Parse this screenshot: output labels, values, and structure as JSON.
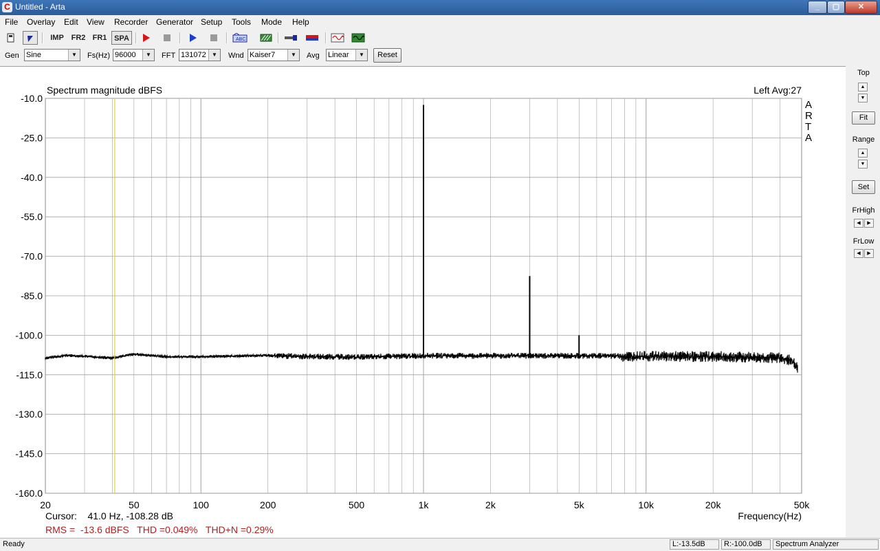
{
  "window": {
    "app_icon": "arta-icon",
    "title": "Untitled - Arta",
    "controls": [
      "minimize-icon",
      "maximize-icon",
      "close-icon"
    ]
  },
  "menu": [
    "File",
    "Overlay",
    "Edit",
    "View",
    "Recorder",
    "Generator",
    "Setup",
    "Tools",
    "Mode",
    "Help"
  ],
  "toolbar": {
    "imp": "IMP",
    "fr2": "FR2",
    "fr1": "FR1",
    "spa": "SPA",
    "icons": [
      "new-icon",
      "cursor-icon",
      "impulse-mode-icon",
      "fr2-mode-icon",
      "fr1-mode-icon",
      "spectrum-mode-icon",
      "record-icon",
      "stop-record-icon",
      "play-icon",
      "stop-play-icon",
      "abc-icon",
      "hatch-icon",
      "probe-icon",
      "level-meter-icon",
      "scope-icon",
      "generator-icon"
    ]
  },
  "controls": {
    "gen_label": "Gen",
    "gen_value": "Sine",
    "fs_label": "Fs(Hz)",
    "fs_value": "96000",
    "fft_label": "FFT",
    "fft_value": "131072",
    "wnd_label": "Wnd",
    "wnd_value": "Kaiser7",
    "avg_label": "Avg",
    "avg_value": "Linear",
    "reset_label": "Reset"
  },
  "plot": {
    "title": "Spectrum magnitude dBFS",
    "channel_info": "Left   Avg:27",
    "watermark": [
      "A",
      "R",
      "T",
      "A"
    ],
    "cursor_text": "Cursor:    41.0 Hz, -108.28 dB",
    "results_text": "RMS =  -13.6 dBFS   THD =0.049%   THD+N =0.29%",
    "colors": {
      "trace": "#000000",
      "grid": "#a0a0a0",
      "cursor": "#e6d23c",
      "results": "#b41e1e"
    }
  },
  "chart_data": {
    "type": "line",
    "title": "Spectrum magnitude dBFS",
    "xlabel": "Frequency(Hz)",
    "ylabel": "",
    "x_scale": "log",
    "xlim": [
      20,
      50000
    ],
    "ylim": [
      -160,
      -10
    ],
    "y_ticks": [
      "-10.0",
      "-25.0",
      "-40.0",
      "-55.0",
      "-70.0",
      "-85.0",
      "-100.0",
      "-115.0",
      "-130.0",
      "-145.0",
      "-160.0"
    ],
    "y_tick_values": [
      -10,
      -25,
      -40,
      -55,
      -70,
      -85,
      -100,
      -115,
      -130,
      -145,
      -160
    ],
    "x_ticks": [
      "20",
      "50",
      "100",
      "200",
      "500",
      "1k",
      "2k",
      "5k",
      "10k",
      "20k",
      "50k"
    ],
    "x_tick_values": [
      20,
      50,
      100,
      200,
      500,
      1000,
      2000,
      5000,
      10000,
      20000,
      50000
    ],
    "grid": true,
    "cursor_hz": 41.0,
    "noise_floor": {
      "x": [
        20,
        25,
        30,
        40,
        50,
        70,
        100,
        200,
        500,
        1000,
        2000,
        5000,
        10000,
        20000,
        40000,
        45000,
        48000
      ],
      "y": [
        -108.5,
        -107.5,
        -107.8,
        -108.5,
        -107,
        -108,
        -108,
        -107.5,
        -108,
        -107.5,
        -107.5,
        -107.5,
        -107.5,
        -107.5,
        -108,
        -109,
        -112
      ]
    },
    "peaks": [
      {
        "x": 1000,
        "y": -12.5
      },
      {
        "x": 3000,
        "y": -77.5
      },
      {
        "x": 5000,
        "y": -100
      }
    ]
  },
  "right_panel": {
    "top_label": "Top",
    "fit_label": "Fit",
    "range_label": "Range",
    "set_label": "Set",
    "frhigh_label": "FrHigh",
    "frlow_label": "FrLow"
  },
  "status": {
    "ready": "Ready",
    "left_level": "L:-13.5dB",
    "right_level": "R:-100.0dB",
    "mode": "Spectrum Analyzer"
  }
}
